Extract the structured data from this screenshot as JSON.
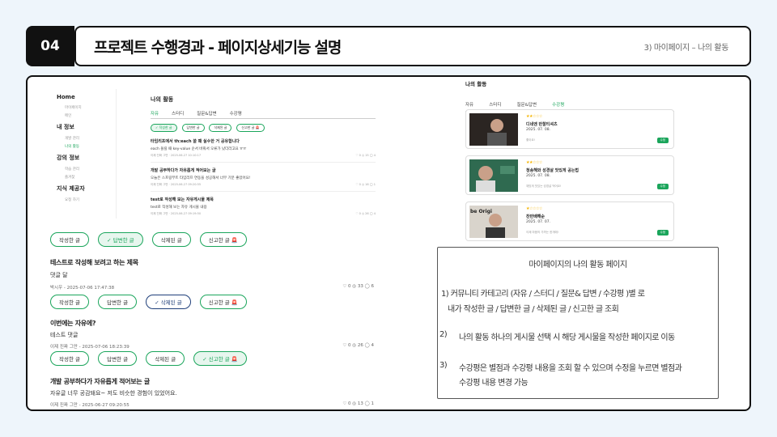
{
  "header": {
    "number": "04",
    "title": "프로젝트 수행경과 - 페이지상세기능 설명",
    "subtitle": "3) 마이페이지 – 나의 활동"
  },
  "sidebar": {
    "sections": [
      {
        "title": "Home",
        "items": [
          "마이페이지",
          "메인"
        ]
      },
      {
        "title": "내 정보",
        "items": [
          "개발 관리",
          "나의 활동"
        ]
      },
      {
        "title": "강의 정보",
        "items": [
          "학습 관리",
          "즐겨찾"
        ]
      },
      {
        "title": "지식 제공자",
        "items": [
          "요청 하기"
        ]
      }
    ]
  },
  "small_screen": {
    "heading": "나의 활동",
    "tabs": [
      "자유",
      "스터디",
      "질문&답변",
      "수강평"
    ],
    "filters": [
      "✓ 작성한 글",
      "답변한 글",
      "삭제된 글",
      "신고한 글 🚨"
    ],
    "posts": [
      {
        "title": "타임리프에서 th:each 쓸 때 실수한 거 공유합니다",
        "body": "each 돌릴 때 key-value 순서 바꿔서 오류가 났더라고요 ㅠㅠ",
        "meta": "이제 진짜 그만 · 2025-06-27 10:10:17",
        "stats": "♡ 0 ◎ 15 ◯ 4"
      },
      {
        "title": "개발 공부하다가 자유롭게 적어보는 글",
        "body": "오늘은 스프링부트 타임리프 연동을 성공해서 너무 기분 좋았어요!",
        "meta": "이제 진짜 그만 · 2025-06-27 09:20:55",
        "stats": "♡ 0 ◎ 16 ◯ 1"
      },
      {
        "title": "test로 작성해 보는 자유게시물 제목",
        "body": "test로 작성해 보는 자유 게시물 내용",
        "meta": "이제 진짜 그만 · 2025-06-27 09:19:50",
        "stats": "♡ 0 ◎ 26 ◯ 4"
      }
    ]
  },
  "groups": [
    {
      "pills": [
        "작성한 글",
        "✓ 답변한 글",
        "삭제된 글",
        "신고한 글 🚨"
      ],
      "selected": 1,
      "title": "테스트로 작성해 보려고 하는 제목",
      "body": "댓글 달",
      "meta": "박시우 - 2025-07-06 17:47:38",
      "stats": "♡ 0 ◎ 33 ◯ 6"
    },
    {
      "pills": [
        "작성한 글",
        "답변한 글",
        "✓ 삭제된 글",
        "신고한 글 🚨"
      ],
      "selected": 2,
      "title": "이번에는 자유에?",
      "body": "테스트 댓글",
      "meta": "이제 진짜 그만 - 2025-07-06 18:23:39",
      "stats": "♡ 0 ◎ 26 ◯ 4"
    },
    {
      "pills": [
        "작성한 글",
        "답변한 글",
        "삭제된 글",
        "✓ 신고한 글 🚨"
      ],
      "selected": 3,
      "title": "개발 공부하다가 자유롭게 적어보는 글",
      "body": "자유글 너무 공감돼요~ 저도 비슷한 경험이 있었어요.",
      "meta": "이제 진짜 그만 - 2025-06-27 09:20:55",
      "stats": "♡ 0 ◎ 13 ◯ 1"
    }
  ],
  "review_panel": {
    "heading": "나의 활동",
    "tabs": [
      "자유",
      "스터디",
      "질문&답변",
      "수강평"
    ],
    "cards": [
      {
        "rating": "★★☆☆☆",
        "title": "디네엔 반찰티셔츠",
        "date": "2025. 07. 08.",
        "note": "좋아요!",
        "button": "수정",
        "thumb_bg": "#3a2e2a"
      },
      {
        "rating": "★★☆☆☆",
        "title": "청송해와 성경살 맛있게 공는법",
        "date": "2025. 07. 08.",
        "note": "재밌게 맛있는 성경살 먹어요!",
        "button": "수정",
        "thumb_bg": "#2e6b4f"
      },
      {
        "rating": "★☆☆☆☆",
        "title": "찬반배해순",
        "date": "2025. 07. 07.",
        "note": "이제 마음의 가까는 한개에!",
        "button": "수정",
        "thumb_bg": "#d9d4cc",
        "thumb_text": "be Origi"
      }
    ]
  },
  "description": {
    "title": "마이페이지의 나의 활동 페이지",
    "lines": [
      "1) 커뮤니티 카테고리 (자유 / 스터디 / 질문& 답변 / 수강평 )별 로",
      "내가 작성한 글 / 답변한 글 / 삭제된 글 / 신고한 글 조회",
      "2)",
      "나의 활동 하나의 게시물 선택 시 해당 게시물을 작성한 페이지로 이동",
      "3)",
      "수강평은 별점과 수강평 내용을 조회 할 수 있으며 수정을 누르면 별점과",
      "수강평 내용 변경 가능"
    ]
  },
  "colors": {
    "accent": "#1aa55b",
    "dark": "#111111",
    "background": "#eef5fb"
  }
}
